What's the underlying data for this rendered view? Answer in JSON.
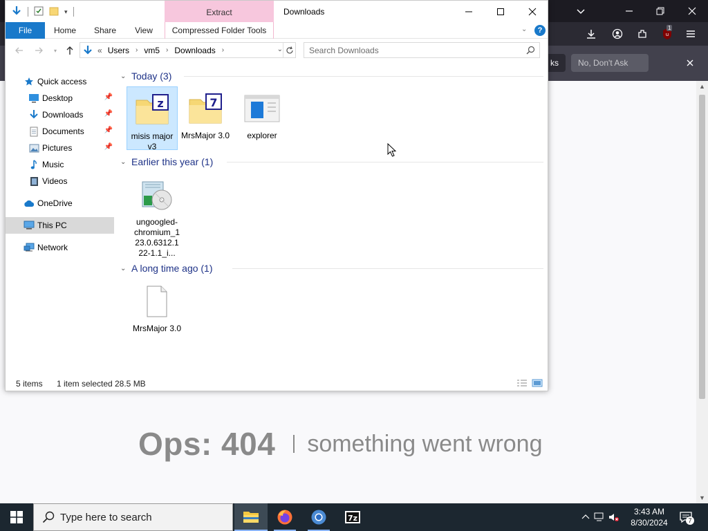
{
  "browser": {
    "notif_buttons": [
      "ks",
      "No, Don't Ask"
    ],
    "error_code": "Ops: 404",
    "error_text": "something went wrong",
    "badge_count": "1"
  },
  "explorer": {
    "window_title": "Downloads",
    "context_tab": "Extract",
    "ribbon_tabs": {
      "file": "File",
      "home": "Home",
      "share": "Share",
      "view": "View",
      "compressed": "Compressed Folder Tools"
    },
    "help": "?",
    "address": {
      "overflow": "«",
      "segments": [
        "Users",
        "vm5",
        "Downloads"
      ]
    },
    "search_placeholder": "Search Downloads",
    "nav": {
      "quick_access": "Quick access",
      "desktop": "Desktop",
      "downloads": "Downloads",
      "documents": "Documents",
      "pictures": "Pictures",
      "music": "Music",
      "videos": "Videos",
      "onedrive": "OneDrive",
      "this_pc": "This PC",
      "network": "Network"
    },
    "groups": [
      {
        "label": "Today (3)",
        "files": [
          "misis major v3",
          "MrsMajor 3.0",
          "explorer"
        ]
      },
      {
        "label": "Earlier this year (1)",
        "files": [
          "ungoogled-chromium_123.0.6312.122-1.1_i..."
        ]
      },
      {
        "label": "A long time ago (1)",
        "files": [
          "MrsMajor 3.0"
        ]
      }
    ],
    "status": {
      "count": "5 items",
      "selected": "1 item selected",
      "size": "28.5 MB"
    }
  },
  "taskbar": {
    "search_placeholder": "Type here to search",
    "time": "3:43 AM",
    "date": "8/30/2024",
    "notification_count": "7"
  }
}
